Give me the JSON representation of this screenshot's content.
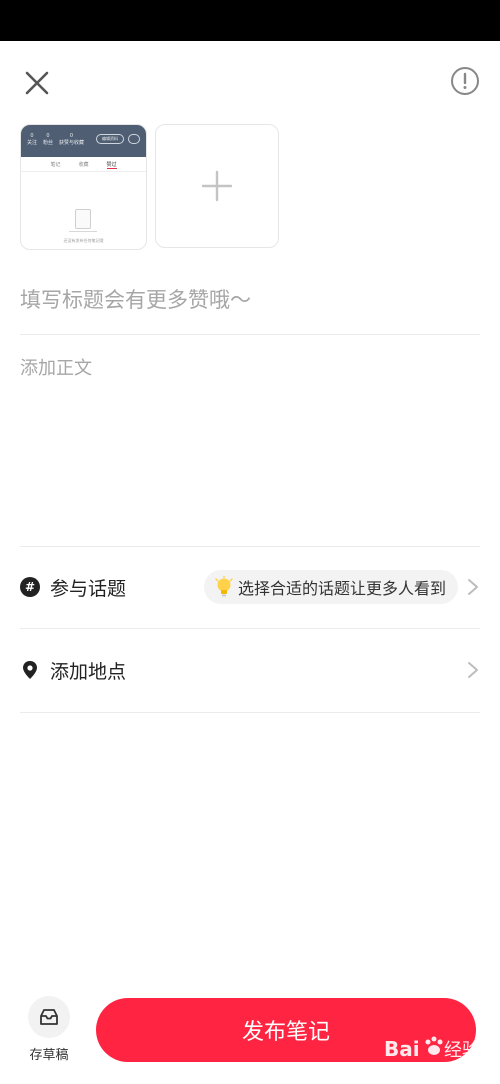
{
  "header": {
    "close_icon": "close-icon",
    "info_icon": "info-icon"
  },
  "media": {
    "thumbnail": {
      "stats": [
        "0\n关注",
        "0\n粉丝",
        "0\n获赞与收藏"
      ],
      "edit_label": "编辑资料",
      "tabs": [
        "笔记",
        "收藏",
        "赞过"
      ],
      "active_tab_index": 2,
      "empty_caption": "还没有发布任何笔记哦"
    },
    "add_icon": "plus-icon"
  },
  "editor": {
    "title_placeholder": "填写标题会有更多赞哦～",
    "body_placeholder": "添加正文"
  },
  "topic": {
    "label": "参与话题",
    "suggestion": "选择合适的话题让更多人看到",
    "icon": "hashtag-icon"
  },
  "location": {
    "label": "添加地点",
    "icon": "location-pin-icon"
  },
  "footer": {
    "draft_label": "存草稿",
    "publish_label": "发布笔记"
  },
  "watermark": {
    "text": "Bai du 经验"
  },
  "colors": {
    "accent": "#ff2442",
    "status_bar": "#000000",
    "thumb_header": "#4f5e72"
  }
}
